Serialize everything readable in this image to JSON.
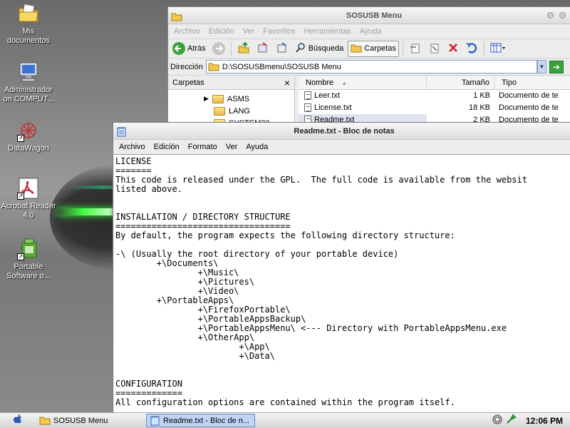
{
  "desktop": {
    "icons": [
      {
        "label": "Mis documentos",
        "icon": "folder-documents-icon"
      },
      {
        "label": "Administrador on COMPUT...",
        "icon": "computer-icon"
      },
      {
        "label": "DataWagon",
        "icon": "datawagon-icon"
      },
      {
        "label": "Acrobat Reader 4.0",
        "icon": "acrobat-icon"
      },
      {
        "label": "Portable Software o...",
        "icon": "portable-software-icon"
      }
    ]
  },
  "explorer": {
    "title": "SOSUSB Menu",
    "menu": [
      "Archivo",
      "Edición",
      "Ver",
      "Favoritos",
      "Herramientas",
      "Ayuda"
    ],
    "toolbar": {
      "back_label": "Atrás",
      "search_label": "Búsqueda",
      "folders_label": "Carpetas"
    },
    "address": {
      "label": "Dirección",
      "value": "D:\\SOSUSBmenu\\SOSUSB Menu"
    },
    "folders_pane": {
      "title": "Carpetas",
      "close": "×",
      "items": [
        "ASMS",
        "LANG",
        "SYSTEM32"
      ]
    },
    "files": {
      "columns": {
        "name": "Nombre",
        "size": "Tamaño",
        "type": "Tipo"
      },
      "rows": [
        {
          "name": "Leer.txt",
          "size": "1 KB",
          "type": "Documento de te"
        },
        {
          "name": "License.txt",
          "size": "18 KB",
          "type": "Documento de te"
        },
        {
          "name": "Readme.txt",
          "size": "2 KB",
          "type": "Documento de te"
        }
      ]
    }
  },
  "notepad": {
    "title": "Readme.txt - Bloc de notas",
    "menu": [
      "Archivo",
      "Edición",
      "Formato",
      "Ver",
      "Ayuda"
    ],
    "content": "LICENSE\n=======\nThis code is released under the GPL.  The full code is available from the websit\nlisted above.\n\n\nINSTALLATION / DIRECTORY STRUCTURE\n==================================\nBy default, the program expects the following directory structure:\n\n-\\ (Usually the root directory of your portable device)\n        +\\Documents\\\n                +\\Music\\\n                +\\Pictures\\\n                +\\Video\\\n        +\\PortableApps\\\n                +\\FirefoxPortable\\\n                +\\PortableAppsBackup\\\n                +\\PortableAppsMenu\\ <--- Directory with PortableAppsMenu.exe\n                +\\OtherApp\\\n                        +\\App\\\n                        +\\Data\\\n\n\nCONFIGURATION\n=============\nAll configuration options are contained within the program itself."
  },
  "taskbar": {
    "tasks": [
      {
        "label": "SOSUSB Menu",
        "active": false
      },
      {
        "label": "Readme.txt - Bloc de n...",
        "active": true
      }
    ],
    "clock": "12:06 PM"
  }
}
